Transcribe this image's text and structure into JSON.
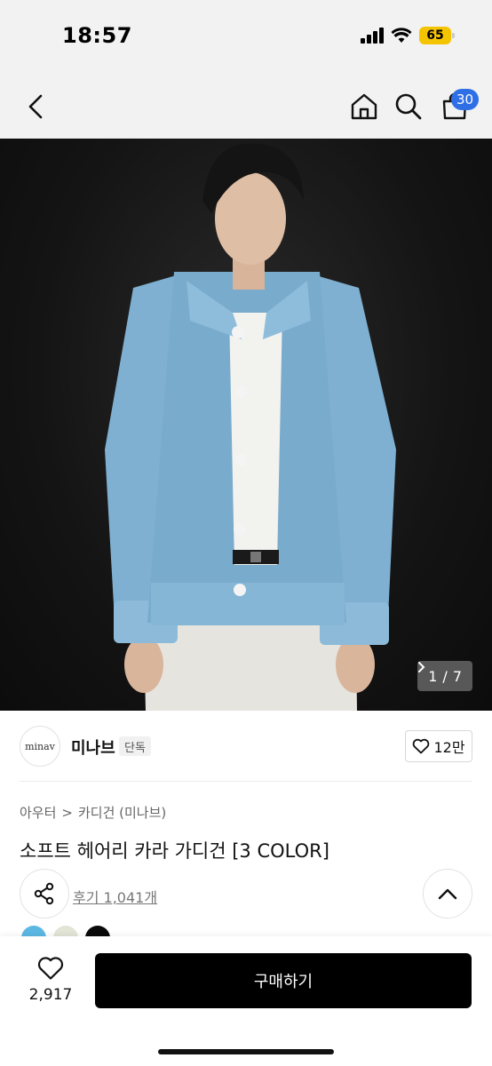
{
  "status_bar": {
    "time": "18:57",
    "battery": "65"
  },
  "nav": {
    "cart_count": "30",
    "icons": [
      "chevron-left-icon",
      "home-icon",
      "search-icon",
      "shopping-bag-icon"
    ]
  },
  "hero": {
    "counter_current": "1",
    "counter_sep": "/",
    "counter_total": "7"
  },
  "brand": {
    "logo_text": "minav",
    "name": "미나브",
    "tag": "단독",
    "likes": "12만"
  },
  "breadcrumb": {
    "category": "아우터",
    "separator": ">",
    "subcategory": "카디건 (미나브)"
  },
  "product": {
    "title": "소프트 헤어리 카라 가디건 [3 COLOR]",
    "reviews_link": "후기 1,041개",
    "swatch_colors": [
      "#5bb8e2",
      "#e2e4d6",
      "#0a0a0a"
    ]
  },
  "bottom_bar": {
    "wish_count": "2,917",
    "buy_label": "구매하기"
  }
}
